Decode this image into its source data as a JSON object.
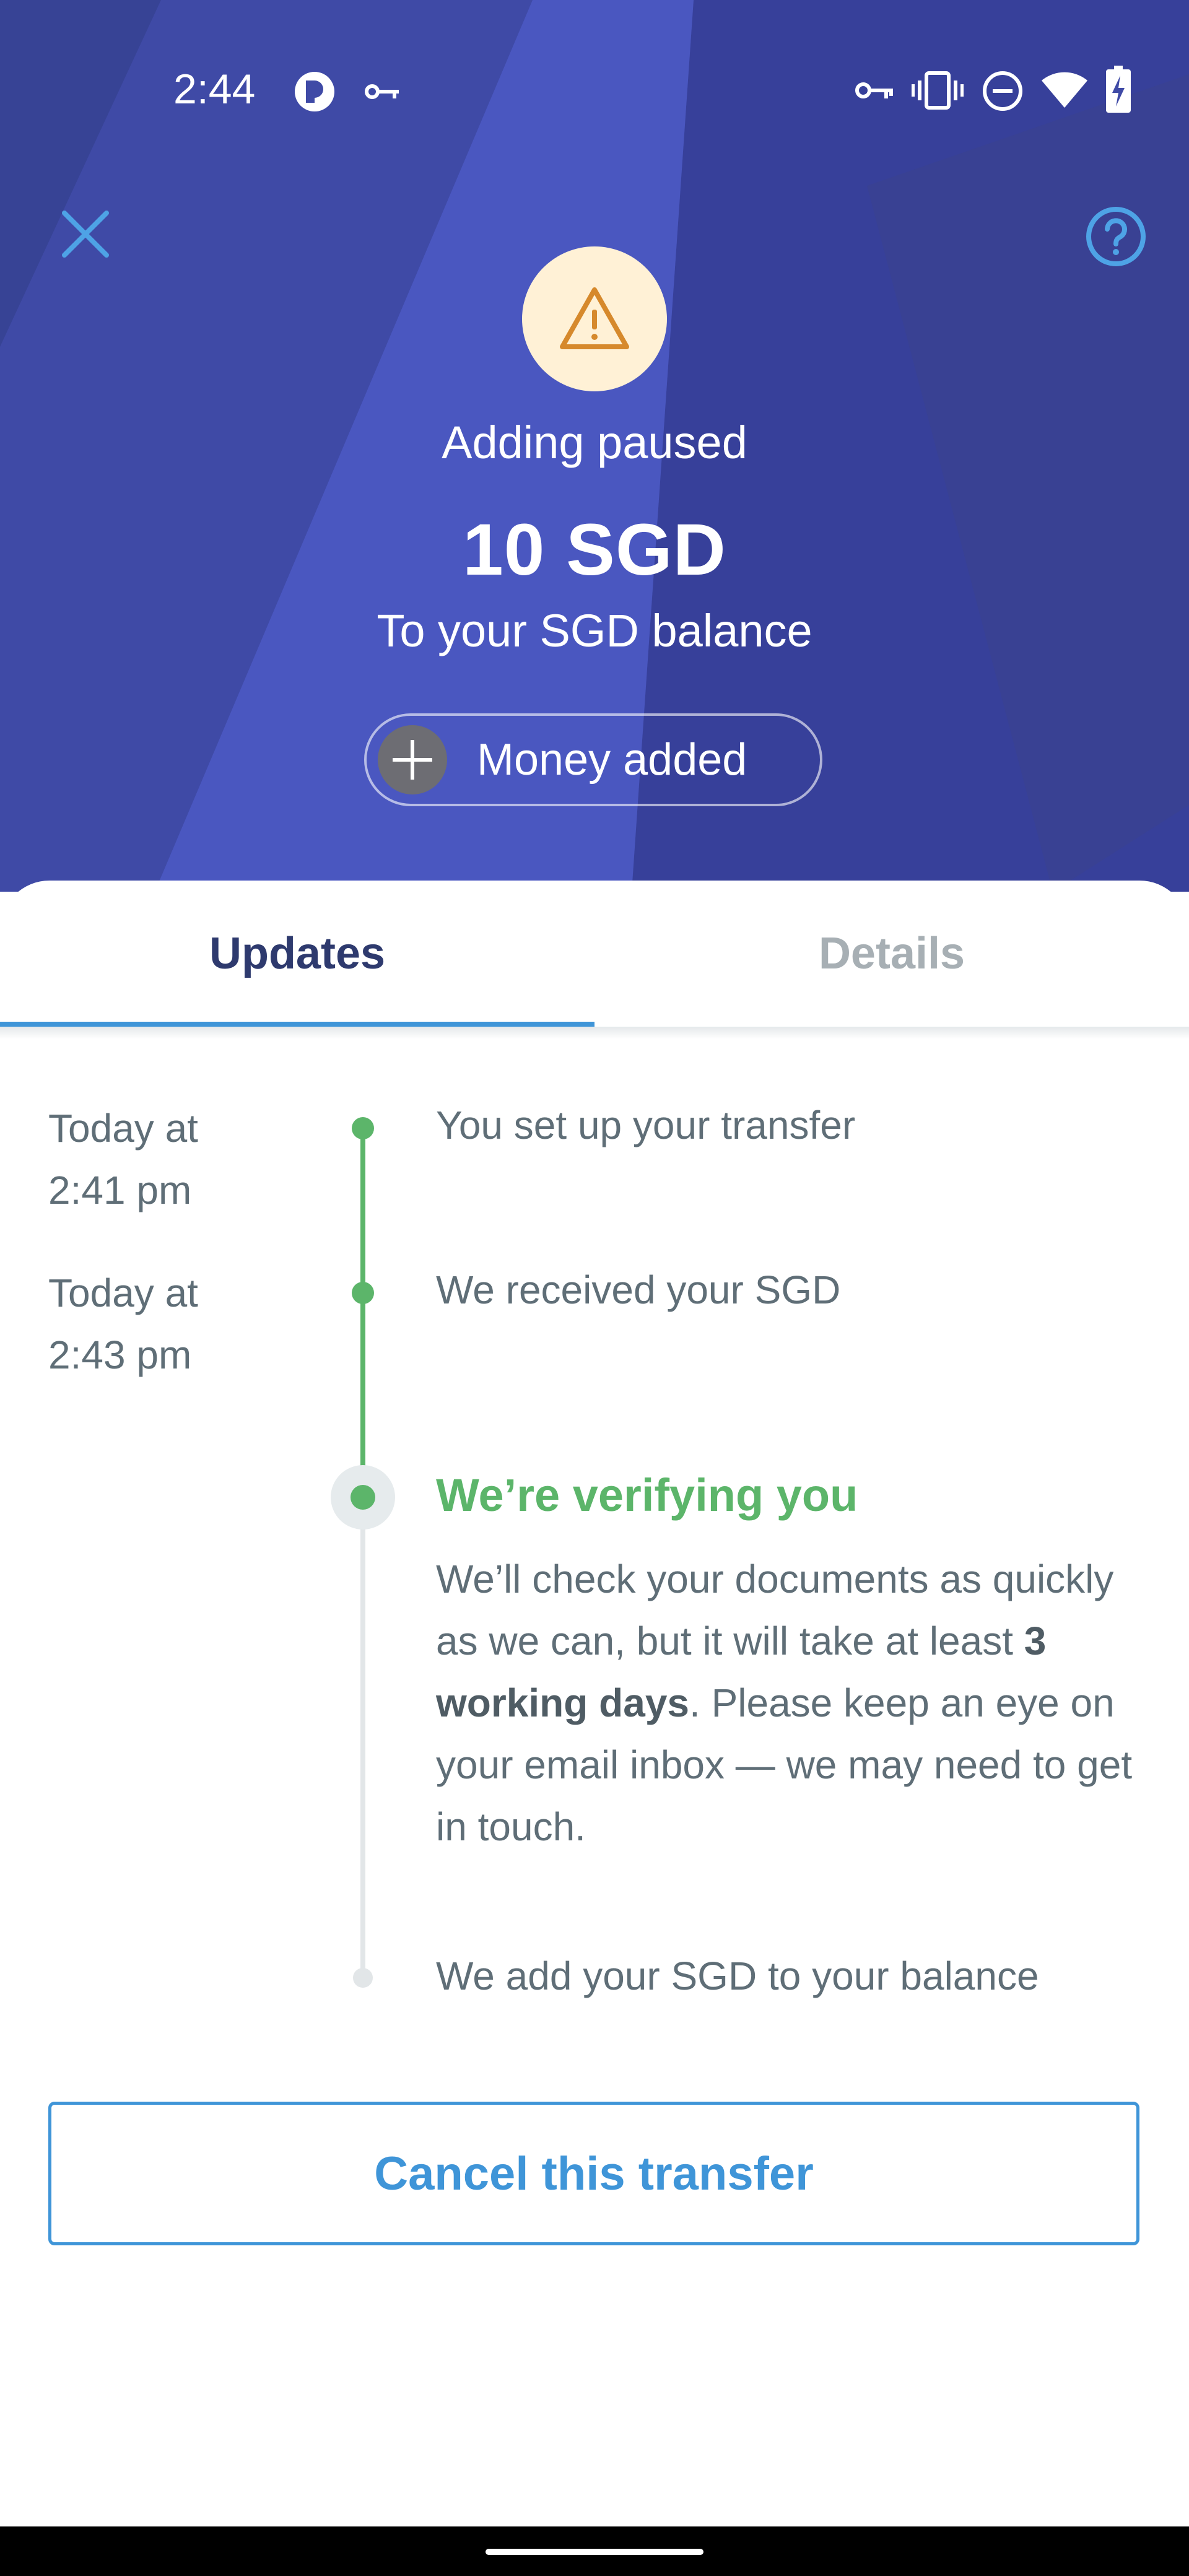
{
  "status_bar": {
    "time": "2:44",
    "left_icons": [
      "app-notification-icon",
      "key-icon"
    ],
    "right_icons": [
      "vpn-key-icon",
      "vibrate-icon",
      "do-not-disturb-icon",
      "wifi-icon",
      "battery-charging-icon"
    ]
  },
  "header": {
    "status_title": "Adding paused",
    "amount": "10 SGD",
    "subtitle": "To your SGD balance",
    "chip_label": "Money added",
    "background_color": "#3f4aa6",
    "warning_color": "#d6892c"
  },
  "tabs": [
    {
      "label": "Updates",
      "active": true
    },
    {
      "label": "Details",
      "active": false
    }
  ],
  "timeline": {
    "events": [
      {
        "time": "Today at\n2:41 pm",
        "label": "You set up your transfer",
        "state": "done"
      },
      {
        "time": "Today at\n2:43 pm",
        "label": "We received your SGD",
        "state": "done"
      },
      {
        "time": "",
        "label": "We’re verifying you",
        "state": "current"
      },
      {
        "time": "",
        "label": "We add your SGD to your balance",
        "state": "pending"
      }
    ],
    "current_description": {
      "before": "We’ll check your documents as quickly as we can, but it will take at least ",
      "emphasis": "3 working days",
      "after": ". Please keep an eye on your email inbox — we may need to get in touch."
    },
    "colors": {
      "done": "#5cb56a",
      "pending": "#e2e6e8"
    }
  },
  "actions": {
    "cancel_label": "Cancel this transfer"
  }
}
